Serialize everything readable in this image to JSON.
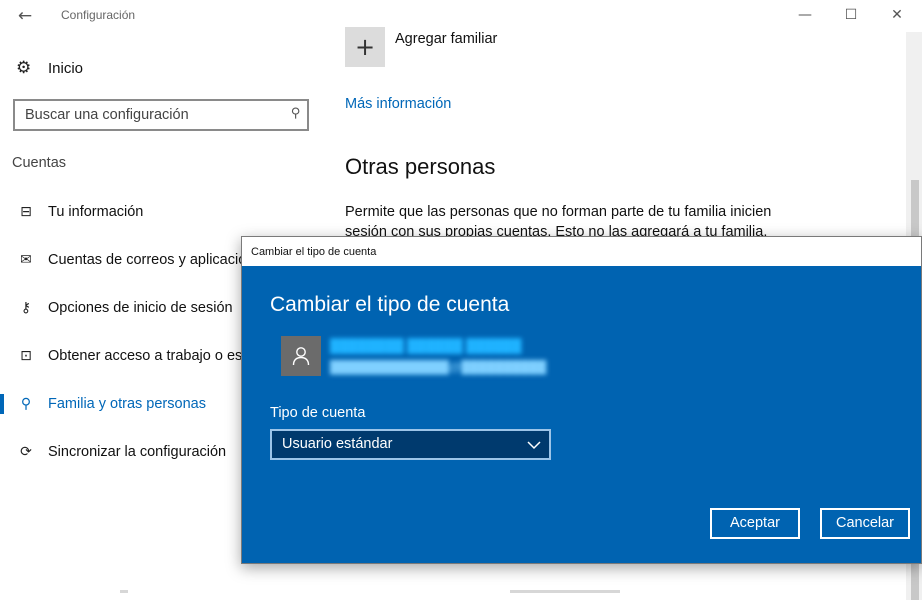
{
  "window": {
    "title": "Configuración",
    "back_icon": "back-arrow-icon",
    "controls": {
      "minimize": "—",
      "maximize": "☐",
      "close": "✕"
    }
  },
  "sidebar": {
    "home_label": "Inicio",
    "search_placeholder": "Buscar una configuración",
    "section_title": "Cuentas",
    "items": [
      {
        "label": "Tu información",
        "icon": "contact-card-icon",
        "glyph": "⊟",
        "active": false
      },
      {
        "label": "Cuentas de correos y aplicaciones",
        "icon": "mail-icon",
        "glyph": "✉",
        "active": false
      },
      {
        "label": "Opciones de inicio de sesión",
        "icon": "key-icon",
        "glyph": "⚷",
        "active": false
      },
      {
        "label": "Obtener acceso a trabajo o escuela",
        "icon": "briefcase-icon",
        "glyph": "⊡",
        "active": false
      },
      {
        "label": "Familia y otras personas",
        "icon": "person-icon",
        "glyph": "⚲",
        "active": true
      },
      {
        "label": "Sincronizar la configuración",
        "icon": "sync-icon",
        "glyph": "⟳",
        "active": false
      }
    ]
  },
  "main": {
    "add_family_label": "Agregar familiar",
    "more_info_link": "Más información",
    "other_people_heading": "Otras personas",
    "other_people_desc": "Permite que las personas que no forman parte de tu familia inicien sesión con sus propias cuentas. Esto no las agregará a tu familia."
  },
  "dialog": {
    "titlebar": "Cambiar el tipo de cuenta",
    "heading": "Cambiar el tipo de cuenta",
    "account_type_label": "Tipo de cuenta",
    "account_type_value": "Usuario estándar",
    "accept_button": "Aceptar",
    "cancel_button": "Cancelar"
  },
  "colors": {
    "accent": "#0067b8",
    "dialog_bg": "#0063b1",
    "select_bg": "#003a6e"
  }
}
